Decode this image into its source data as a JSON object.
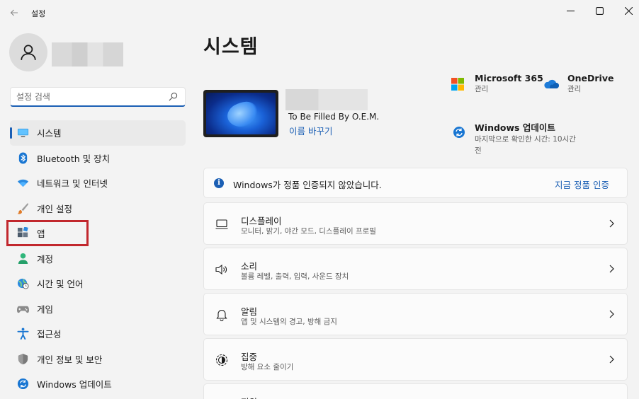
{
  "window": {
    "title": "설정"
  },
  "search": {
    "placeholder": "설정 검색"
  },
  "sidebar": {
    "items": [
      {
        "label": "시스템",
        "icon": "monitor-icon",
        "active": true
      },
      {
        "label": "Bluetooth 및 장치",
        "icon": "bluetooth-icon"
      },
      {
        "label": "네트워크 및 인터넷",
        "icon": "wifi-icon"
      },
      {
        "label": "개인 설정",
        "icon": "brush-icon"
      },
      {
        "label": "앱",
        "icon": "apps-icon"
      },
      {
        "label": "계정",
        "icon": "account-icon"
      },
      {
        "label": "시간 및 언어",
        "icon": "globe-clock-icon"
      },
      {
        "label": "게임",
        "icon": "gamepad-icon"
      },
      {
        "label": "접근성",
        "icon": "accessibility-icon"
      },
      {
        "label": "개인 정보 및 보안",
        "icon": "shield-icon"
      },
      {
        "label": "Windows 업데이트",
        "icon": "update-icon"
      }
    ]
  },
  "main": {
    "title": "시스템",
    "device": {
      "model": "To Be Filled By O.E.M.",
      "rename": "이름 바꾸기"
    },
    "quick_links": {
      "m365": {
        "title": "Microsoft 365",
        "sub": "관리"
      },
      "onedrive": {
        "title": "OneDrive",
        "sub": "관리"
      },
      "update": {
        "title": "Windows 업데이트",
        "sub1": "마지막으로 확인한 시간: 10시간",
        "sub2": "전"
      }
    },
    "banner": {
      "text": "Windows가 정품 인증되지 않았습니다.",
      "action": "지금 정품 인증"
    },
    "cards": [
      {
        "title": "디스플레이",
        "sub": "모니터, 밝기, 야간 모드, 디스플레이 프로필",
        "icon": "display-icon"
      },
      {
        "title": "소리",
        "sub": "볼륨 레벨, 출력, 입력, 사운드 장치",
        "icon": "speaker-icon"
      },
      {
        "title": "알림",
        "sub": "앱 및 시스템의 경고, 방해 금지",
        "icon": "bell-icon"
      },
      {
        "title": "집중",
        "sub": "방해 요소 줄이기",
        "icon": "focus-icon"
      },
      {
        "title": "전원",
        "sub": "",
        "icon": "power-icon"
      }
    ]
  },
  "colors": {
    "accent": "#1b5fb4",
    "highlight_box": "#c1272d"
  }
}
